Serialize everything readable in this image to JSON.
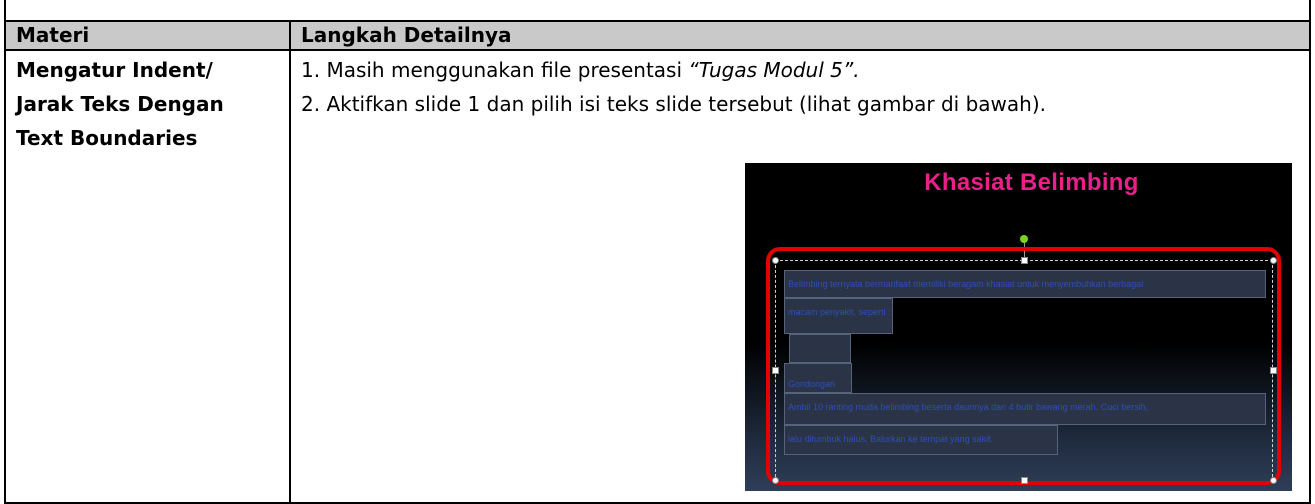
{
  "table": {
    "header": {
      "col1": "Materi",
      "col2": "Langkah Detailnya"
    },
    "materi": [
      "Mengatur Indent/",
      "Jarak Teks Dengan",
      "Text Boundaries"
    ],
    "steps": {
      "step1_prefix": "1. Masih menggunakan file presentasi ",
      "step1_italic": "“Tugas Modul 5”.",
      "step2": "2. Aktifkan slide 1 dan pilih isi teks slide tersebut (lihat gambar di bawah)."
    }
  },
  "slide": {
    "title": "Khasiat Belimbing",
    "title_color": "#e8208a",
    "highlight_color": "#e40000",
    "lines": [
      "Belimbing ternyata bermanfaat memiliki beragam khasiat untuk menyembuhkan berbagai",
      "macam penyakit, seperti :",
      "Gondongan",
      "Ambil 10 ranting muda belimbing beserta daunnya dan 4 butir bawang merah. Cuci bersih,",
      "lalu ditumbuk halus. Balurkan ke tempat yang sakit."
    ]
  }
}
